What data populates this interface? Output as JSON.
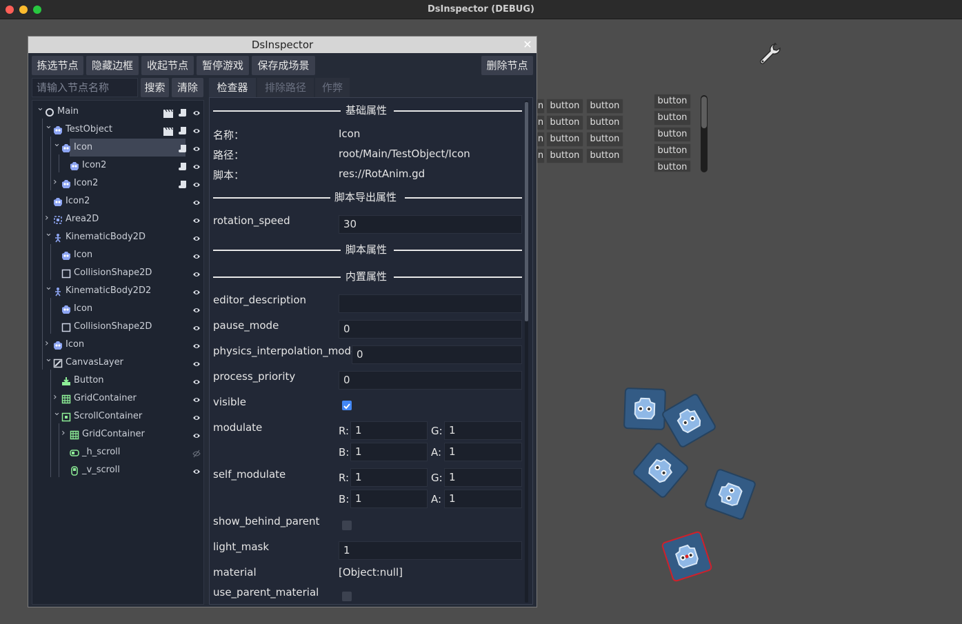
{
  "app": {
    "title": "DsInspector (DEBUG)"
  },
  "window": {
    "title": "DsInspector",
    "close": "✕"
  },
  "toolbar": {
    "pick": "拣选节点",
    "hide_border": "隐藏边框",
    "collapse": "收起节点",
    "pause": "暂停游戏",
    "save_scene": "保存成场景",
    "delete": "删除节点"
  },
  "search": {
    "placeholder": "请输入节点名称",
    "search": "搜索",
    "clear": "清除"
  },
  "tabs": {
    "inspector": "检查器",
    "exclude": "排除路径",
    "cheat": "作弊"
  },
  "tree": {
    "nodes": [
      {
        "label": "Main",
        "icon": "node-circle-icon"
      },
      {
        "label": "TestObject",
        "icon": "godot-icon"
      },
      {
        "label": "Icon",
        "icon": "godot-icon",
        "selected": true
      },
      {
        "label": "Icon2",
        "icon": "godot-icon"
      },
      {
        "label": "Icon2",
        "icon": "godot-icon"
      },
      {
        "label": "Icon2",
        "icon": "godot-icon"
      },
      {
        "label": "Area2D",
        "icon": "area2d-icon"
      },
      {
        "label": "KinematicBody2D",
        "icon": "kinematic-body-icon"
      },
      {
        "label": "Icon",
        "icon": "godot-icon"
      },
      {
        "label": "CollisionShape2D",
        "icon": "collision-shape-icon"
      },
      {
        "label": "KinematicBody2D2",
        "icon": "kinematic-body-icon"
      },
      {
        "label": "Icon",
        "icon": "godot-icon"
      },
      {
        "label": "CollisionShape2D",
        "icon": "collision-shape-icon"
      },
      {
        "label": "Icon",
        "icon": "godot-icon"
      },
      {
        "label": "CanvasLayer",
        "icon": "canvas-layer-icon"
      },
      {
        "label": "Button",
        "icon": "button-node-icon"
      },
      {
        "label": "GridContainer",
        "icon": "grid-container-icon"
      },
      {
        "label": "ScrollContainer",
        "icon": "scroll-container-icon"
      },
      {
        "label": "GridContainer",
        "icon": "grid-container-icon"
      },
      {
        "label": "_h_scroll",
        "icon": "hscroll-icon"
      },
      {
        "label": "_v_scroll",
        "icon": "vscroll-icon"
      }
    ]
  },
  "inspector": {
    "sections": {
      "basic": "基础属性",
      "script_export": "脚本导出属性",
      "script": "脚本属性",
      "builtin": "内置属性"
    },
    "basic": {
      "name_label": "名称：",
      "name_value": "Icon",
      "path_label": "路径：",
      "path_value": "root/Main/TestObject/Icon",
      "script_label": "脚本：",
      "script_value": "res://RotAnim.gd"
    },
    "export": {
      "rotation_speed_label": "rotation_speed",
      "rotation_speed_value": "30"
    },
    "props": {
      "editor_description_label": "editor_description",
      "editor_description_value": "",
      "pause_mode_label": "pause_mode",
      "pause_mode_value": "0",
      "physics_interpolation_mode_label": "physics_interpolation_mode",
      "physics_interpolation_mode_value": "0",
      "process_priority_label": "process_priority",
      "process_priority_value": "0",
      "visible_label": "visible",
      "visible_checked": true,
      "modulate_label": "modulate",
      "modulate": {
        "r": "1",
        "g": "1",
        "b": "1",
        "a": "1"
      },
      "self_modulate_label": "self_modulate",
      "self_modulate": {
        "r": "1",
        "g": "1",
        "b": "1",
        "a": "1"
      },
      "channel": {
        "r": "R:",
        "g": "G:",
        "b": "B:",
        "a": "A:"
      },
      "show_behind_parent_label": "show_behind_parent",
      "show_behind_parent_checked": false,
      "light_mask_label": "light_mask",
      "light_mask_value": "1",
      "material_label": "material",
      "material_value": "[Object:null]",
      "use_parent_material_label": "use_parent_material",
      "use_parent_material_checked": false
    }
  },
  "scene": {
    "button_label": "button",
    "button_fragment": "n"
  },
  "colors": {
    "selection": "#3f4656",
    "sprite": "#335b85",
    "checkbox": "#4287f5",
    "selected_outline": "#d0202a"
  }
}
